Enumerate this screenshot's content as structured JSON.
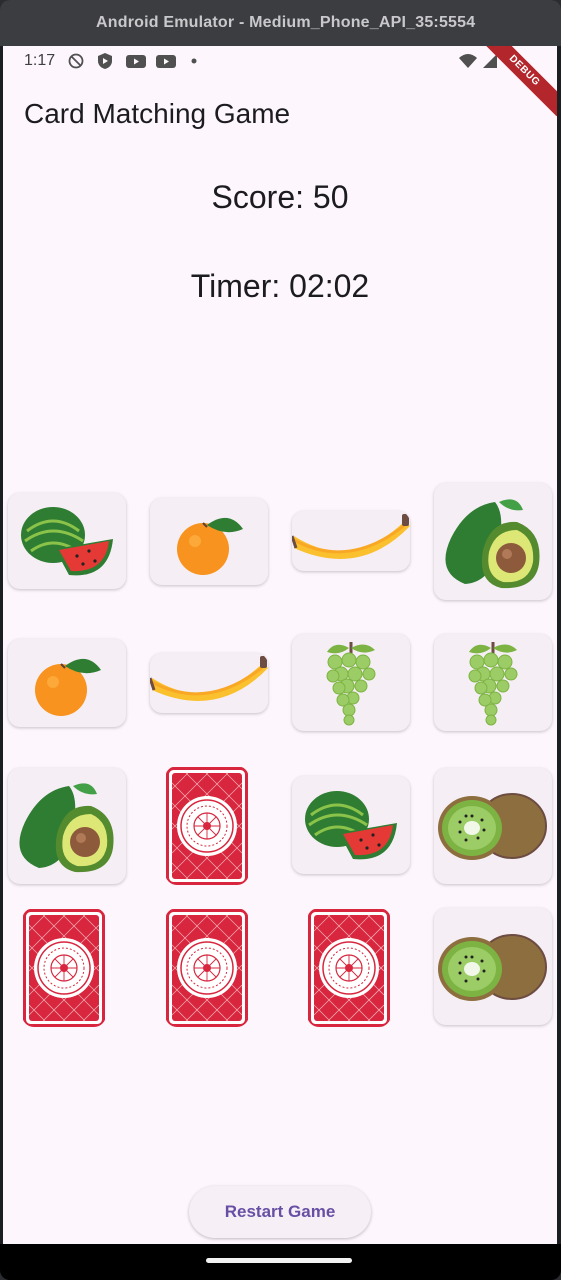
{
  "window": {
    "title": "Android Emulator - Medium_Phone_API_35:5554"
  },
  "status_bar": {
    "time": "1:17",
    "debug_label": "DEBUG"
  },
  "app": {
    "title": "Card Matching Game"
  },
  "game": {
    "score": "Score: 50",
    "timer": "Timer: 02:02"
  },
  "cards": [
    {
      "face": "watermelon",
      "state": "face-up"
    },
    {
      "face": "orange",
      "state": "face-up"
    },
    {
      "face": "banana",
      "state": "face-up"
    },
    {
      "face": "avocado",
      "state": "face-up"
    },
    {
      "face": "orange",
      "state": "face-up"
    },
    {
      "face": "banana",
      "state": "face-up"
    },
    {
      "face": "grapes",
      "state": "face-up"
    },
    {
      "face": "grapes",
      "state": "face-up"
    },
    {
      "face": "avocado",
      "state": "face-up"
    },
    {
      "face": "card-back",
      "state": "face-down"
    },
    {
      "face": "watermelon",
      "state": "face-up"
    },
    {
      "face": "kiwi",
      "state": "face-up"
    },
    {
      "face": "card-back",
      "state": "face-down"
    },
    {
      "face": "card-back",
      "state": "face-down"
    },
    {
      "face": "card-back",
      "state": "face-down"
    },
    {
      "face": "kiwi",
      "state": "face-up"
    }
  ],
  "actions": {
    "restart_label": "Restart Game"
  },
  "colors": {
    "accent": "#6750a4",
    "card_back": "#d7263d",
    "background": "#fdf7fd"
  }
}
